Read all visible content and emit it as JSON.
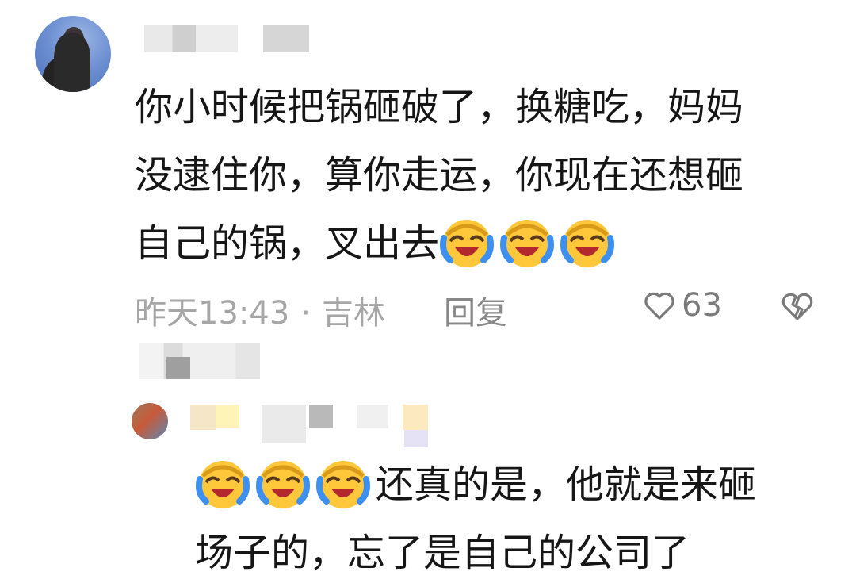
{
  "comment": {
    "text_lines": [
      "你小时候把锅砸破了，换糖吃，妈妈",
      "没逮住你，算你走运，你现在还想砸",
      "自己的锅，叉出去"
    ],
    "trailing_emojis": [
      "laughing-crying-emoji",
      "laughing-crying-emoji",
      "laughing-crying-emoji"
    ],
    "time": "昨天13:43",
    "separator": "·",
    "location": "吉林",
    "reply_label": "回复",
    "likes": "63"
  },
  "reply": {
    "leading_emojis": [
      "laughing-crying-emoji",
      "laughing-crying-emoji",
      "laughing-crying-emoji"
    ],
    "text_line1": "还真的是，他就是来砸",
    "text_line2": "场子的，忘了是自己的公司了"
  },
  "colors": {
    "meta_text": "#a6a6a6",
    "body_text": "#161616",
    "emoji_yellow": "#ffc83a",
    "emoji_tear": "#3d8ff0"
  }
}
